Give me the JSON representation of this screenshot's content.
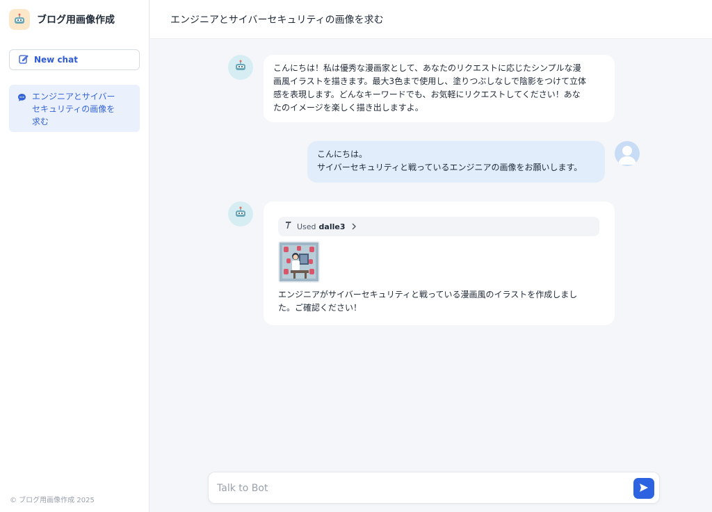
{
  "app": {
    "title": "ブログ用画像作成",
    "logo_icon": "robot-icon",
    "footer": "© ブログ用画像作成 2025"
  },
  "sidebar": {
    "new_chat_label": "New chat",
    "new_chat_icon": "edit-icon",
    "history": [
      {
        "label": "エンジニアとサイバーセキュリティの画像を求む",
        "icon": "chat-bubble-icon"
      }
    ]
  },
  "conversation": {
    "title": "エンジニアとサイバーセキュリティの画像を求む",
    "messages": [
      {
        "role": "bot",
        "lines": [
          "こんにちは！私は優秀な漫画家として、あなたのリクエストに応じたシンプルな漫",
          "画風イラストを描きます。最大3色まで使用し、塗りつぶしなしで陰影をつけて立体",
          "感を表現します。どんなキーワードでも、お気軽にリクエストしてください！あな",
          "たのイメージを楽しく描き出しますよ。"
        ]
      },
      {
        "role": "user",
        "lines": [
          "こんにちは。",
          "サイバーセキュリティと戦っているエンジニアの画像をお願いします。"
        ]
      },
      {
        "role": "bot",
        "tool": {
          "prefix": "Used",
          "name": "dalle3"
        },
        "image_alt": "engineer-cybersecurity-illustration",
        "lines": [
          "エンジニアがサイバーセキュリティと戦っている漫画風のイラストを作成しまし",
          "た。ご確認ください！"
        ]
      }
    ]
  },
  "composer": {
    "placeholder": "Talk to Bot",
    "send_icon": "send-icon"
  },
  "colors": {
    "accent": "#2d63e0",
    "user_bubble": "#e1edfb",
    "bot_avatar": "#d6eef3",
    "history_active": "#eaf1fd"
  }
}
